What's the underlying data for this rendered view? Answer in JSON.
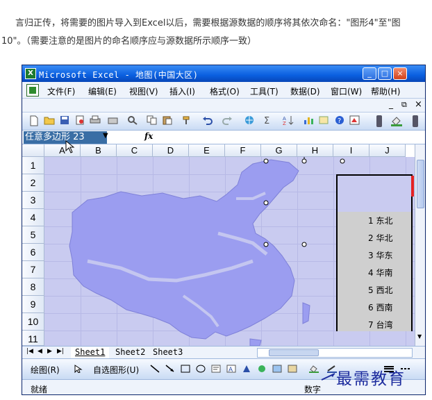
{
  "article": {
    "line1": "言归正传，将需要的图片导入到Excel以后，需要根据源数据的顺序将其依次命名：\"图形4\"至\"图",
    "line2": "10\"。（需要注意的是图片的命名顺序应与源数据所示顺序一致）"
  },
  "window": {
    "title": "Microsoft Excel - 地图(中国大区)",
    "app_icon": "X",
    "min_label": "_",
    "max_label": "□",
    "close_label": "×"
  },
  "menu": {
    "items": [
      "文件(F)",
      "编辑(E)",
      "视图(V)",
      "插入(I)",
      "格式(O)",
      "工具(T)",
      "数据(D)",
      "窗口(W)",
      "帮助(H)"
    ],
    "doc_min": "_",
    "doc_restore": "⧉",
    "doc_close": "×"
  },
  "formula_bar": {
    "name_box": "任意多边形 23",
    "fx": "fx"
  },
  "columns": [
    "A",
    "B",
    "C",
    "D",
    "E",
    "F",
    "G",
    "H",
    "I",
    "J"
  ],
  "rows": [
    "1",
    "2",
    "3",
    "4",
    "5",
    "6",
    "7",
    "8",
    "9",
    "10",
    "11"
  ],
  "legend": {
    "items": [
      "1 东北",
      "2 华北",
      "3 华东",
      "4 华南",
      "5 西北",
      "6 西南",
      "7 台湾"
    ]
  },
  "sheets": {
    "tabs": [
      "Sheet1",
      "Sheet2",
      "Sheet3"
    ],
    "active": "Sheet1"
  },
  "drawing_bar": {
    "draw_label": "绘图(R)",
    "autoshape_label": "自选图形(U)"
  },
  "status": {
    "left": "就绪",
    "right": "数字"
  },
  "watermark": "最需教育",
  "colors": {
    "map_fill": "#9b9df0",
    "cell_fill": "#c9cbf0",
    "title_bar": "#0a5fe0",
    "legend_fill": "#cfcfcf"
  }
}
